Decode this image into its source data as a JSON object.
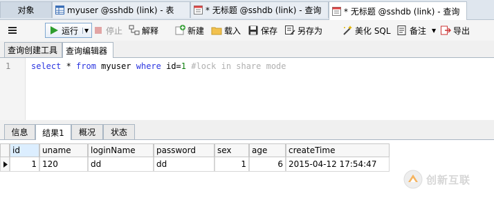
{
  "tabs": [
    {
      "label": "对象",
      "icon": "none"
    },
    {
      "label": "myuser @sshdb (link) - 表",
      "icon": "table-icon"
    },
    {
      "label": "* 无标题 @sshdb (link) - 查询",
      "icon": "query-icon"
    },
    {
      "label": "* 无标题 @sshdb (link) - 查询",
      "icon": "query-icon"
    }
  ],
  "toolbar": {
    "menu_icon": "hamburger-icon",
    "run_label": "运行",
    "stop_label": "停止",
    "explain_label": "解释",
    "new_label": "新建",
    "load_label": "载入",
    "save_label": "保存",
    "save_as_label": "另存为",
    "beautify_label": "美化 SQL",
    "note_label": "备注",
    "export_label": "导出"
  },
  "subtabs": [
    "查询创建工具",
    "查询编辑器"
  ],
  "editor": {
    "line_number": "1",
    "sql": {
      "t1": "select",
      "t2": " * ",
      "t3": "from",
      "t4": " myuser ",
      "t5": "where",
      "t6": " id=",
      "t7": "1",
      "t8": " #lock in share mode"
    }
  },
  "result_tabs": [
    "信息",
    "结果1",
    "概况",
    "状态"
  ],
  "grid": {
    "columns": [
      "id",
      "uname",
      "loginName",
      "password",
      "sex",
      "age",
      "createTime"
    ],
    "rows": [
      [
        "1",
        "120",
        "dd",
        "dd",
        "1",
        "6",
        "2015-04-12 17:54:47"
      ]
    ]
  },
  "watermark": {
    "text": "创新互联",
    "icon": "logo-icon"
  },
  "colors": {
    "keyword": "#2b35e0",
    "number": "#108010",
    "comment": "#b0b0b0",
    "selected_header": "#dceeff"
  }
}
